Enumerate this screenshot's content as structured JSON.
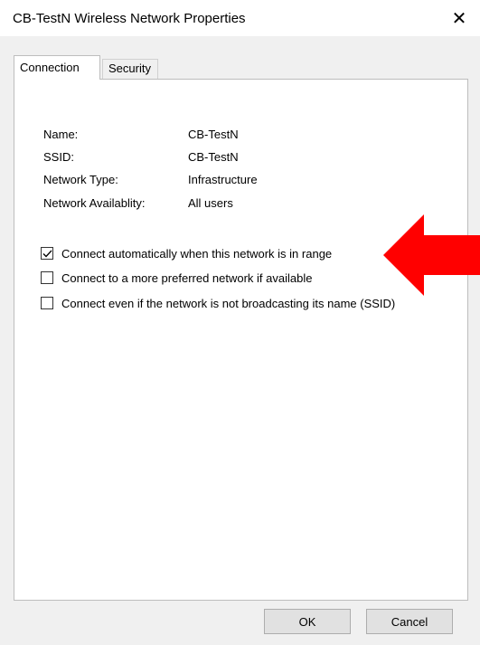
{
  "window": {
    "title": "CB-TestN Wireless Network Properties",
    "close_glyph": "✕"
  },
  "tabs": [
    {
      "label": "Connection",
      "active": true
    },
    {
      "label": "Security",
      "active": false
    }
  ],
  "info": {
    "name_label": "Name:",
    "name_value": "CB-TestN",
    "ssid_label": "SSID:",
    "ssid_value": "CB-TestN",
    "type_label": "Network Type:",
    "type_value": "Infrastructure",
    "availability_label": "Network Availablity:",
    "availability_value": "All users"
  },
  "options": [
    {
      "label": "Connect automatically when this network is in range",
      "checked": true
    },
    {
      "label": "Connect to a more preferred  network if available",
      "checked": false
    },
    {
      "label": "Connect even if  the network is not  broadcasting its name (SSID)",
      "checked": false
    }
  ],
  "annotation": {
    "arrow_color": "#ff0000",
    "arrow_icon": "arrow-left-icon"
  },
  "buttons": {
    "ok_label": "OK",
    "cancel_label": "Cancel"
  }
}
